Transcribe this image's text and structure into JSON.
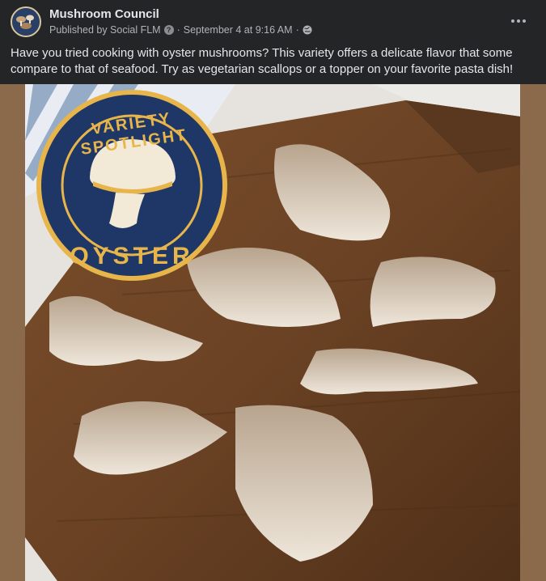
{
  "post": {
    "page_name": "Mushroom Council",
    "published_by": "Published by Social FLM",
    "separator": "·",
    "timestamp": "September 4 at 9:16 AM",
    "text": "Have you tried cooking with oyster mushrooms? This variety offers a delicate flavor that some compare to that of seafood. Try as vegetarian scallops or a topper on your favorite pasta dish!"
  },
  "image": {
    "badge_top_text": "VARIETY SPOTLIGHT",
    "badge_bottom_text": "OYSTER"
  },
  "icons": {
    "info": "info-icon",
    "audience": "globe-icon",
    "more": "more-options-icon"
  },
  "colors": {
    "background": "#242526",
    "primary_text": "#e4e6eb",
    "secondary_text": "#b0b3b8",
    "badge_navy": "#1e3766",
    "badge_gold": "#e8b54a",
    "frame_brown": "#8a6a4a"
  }
}
